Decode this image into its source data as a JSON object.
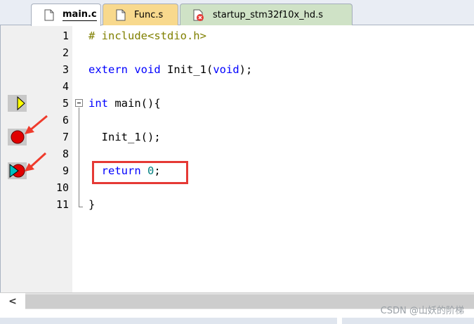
{
  "tabs": [
    {
      "label": "main.c",
      "icon": "c-file-icon",
      "active": true
    },
    {
      "label": "Func.s",
      "icon": "asm-file-icon",
      "active": false
    },
    {
      "label": "startup_stm32f10x_hd.s",
      "icon": "asm-file-error-icon",
      "active": false
    }
  ],
  "editor": {
    "lines": [
      {
        "num": "1",
        "code": "# include<stdio.h>"
      },
      {
        "num": "2",
        "code": ""
      },
      {
        "num": "3",
        "code": "extern void Init_1(void);"
      },
      {
        "num": "4",
        "code": ""
      },
      {
        "num": "5",
        "code": "int main(){"
      },
      {
        "num": "6",
        "code": ""
      },
      {
        "num": "7",
        "code": "  Init_1();"
      },
      {
        "num": "8",
        "code": ""
      },
      {
        "num": "9",
        "code": "  return 0;"
      },
      {
        "num": "10",
        "code": ""
      },
      {
        "num": "11",
        "code": "}"
      }
    ],
    "markers": [
      {
        "line": "5",
        "type": "current-execution-arrow-icon"
      },
      {
        "line": "7",
        "type": "breakpoint-icon"
      },
      {
        "line": "9",
        "type": "breakpoint-with-arrow-icon"
      }
    ]
  },
  "scrollbar": {
    "left_arrow": "<"
  },
  "watermark": "CSDN @山妖的阶梯",
  "colors": {
    "keyword": "#0000ff",
    "preprocessor": "#808000",
    "number": "#008080",
    "highlight": "#e53935",
    "breakpoint": "#e00000"
  }
}
